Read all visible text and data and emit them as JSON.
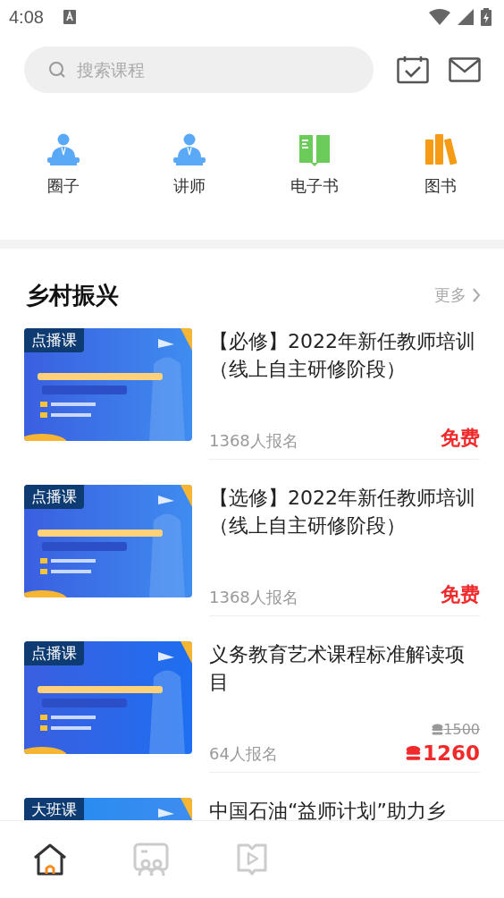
{
  "status_bar": {
    "time": "4:08"
  },
  "search": {
    "placeholder": "搜索课程"
  },
  "shortcuts": [
    {
      "label": "圈子",
      "kind": "lecturer"
    },
    {
      "label": "讲师",
      "kind": "lecturer"
    },
    {
      "label": "电子书",
      "kind": "ebook"
    },
    {
      "label": "图书",
      "kind": "books"
    }
  ],
  "section": {
    "title": "乡村振兴",
    "more": "更多"
  },
  "courses": [
    {
      "badge": "点播课",
      "title": "【必修】2022年新任教师培训（线上自主研修阶段）",
      "enrolled": "1368人报名",
      "kind": "free",
      "price": "免费"
    },
    {
      "badge": "点播课",
      "title": "【选修】2022年新任教师培训（线上自主研修阶段）",
      "enrolled": "1368人报名",
      "kind": "free",
      "price": "免费"
    },
    {
      "badge": "点播课",
      "title": "义务教育艺术课程标准解读项目",
      "enrolled": "64人报名",
      "kind": "paid",
      "original_price": "1500",
      "price": "1260"
    },
    {
      "badge": "大班课",
      "title": "中国石油“益师计划”助力乡"
    }
  ],
  "tab_bar": [
    {
      "kind": "home",
      "selected": true
    },
    {
      "kind": "classroom",
      "selected": false
    },
    {
      "kind": "video",
      "selected": false
    }
  ]
}
